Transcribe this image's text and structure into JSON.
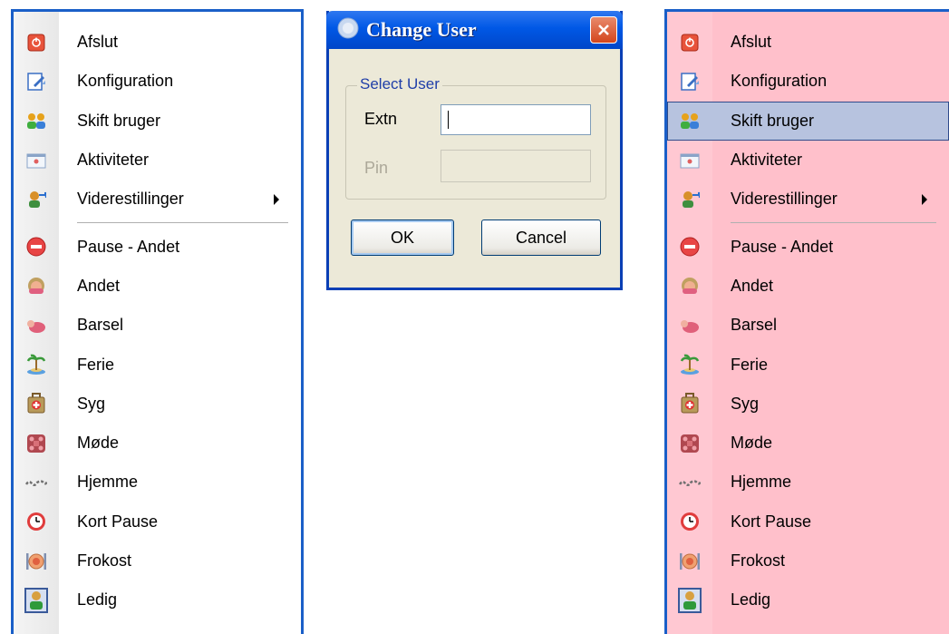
{
  "left_menu": {
    "items_top": [
      {
        "label": "Afslut",
        "icon": "power-icon"
      },
      {
        "label": "Konfiguration",
        "icon": "configuration-icon"
      },
      {
        "label": "Skift bruger",
        "icon": "switch-user-icon"
      },
      {
        "label": "Aktiviteter",
        "icon": "activities-icon"
      },
      {
        "label": "Viderestillinger",
        "icon": "forwarding-icon",
        "submenu": true
      }
    ],
    "items_bottom": [
      {
        "label": "Pause - Andet",
        "icon": "no-entry-icon"
      },
      {
        "label": "Andet",
        "icon": "person-face-icon"
      },
      {
        "label": "Barsel",
        "icon": "baby-icon"
      },
      {
        "label": "Ferie",
        "icon": "palm-island-icon"
      },
      {
        "label": "Syg",
        "icon": "medical-kit-icon"
      },
      {
        "label": "Møde",
        "icon": "meeting-icon"
      },
      {
        "label": "Hjemme",
        "icon": "home-icon"
      },
      {
        "label": "Kort Pause",
        "icon": "clock-icon"
      },
      {
        "label": "Frokost",
        "icon": "lunch-icon"
      },
      {
        "label": "Ledig",
        "icon": "available-user-icon",
        "checked": true
      }
    ]
  },
  "right_menu": {
    "background": "#ffc0cb",
    "highlighted_item": "Skift bruger",
    "items_top": [
      {
        "label": "Afslut"
      },
      {
        "label": "Konfiguration"
      },
      {
        "label": "Skift bruger"
      },
      {
        "label": "Aktiviteter"
      },
      {
        "label": "Viderestillinger"
      }
    ],
    "items_bottom": [
      {
        "label": "Pause - Andet"
      },
      {
        "label": "Andet"
      },
      {
        "label": "Barsel"
      },
      {
        "label": "Ferie"
      },
      {
        "label": "Syg"
      },
      {
        "label": "Møde"
      },
      {
        "label": "Hjemme"
      },
      {
        "label": "Kort Pause"
      },
      {
        "label": "Frokost"
      },
      {
        "label": "Ledig"
      }
    ]
  },
  "dialog": {
    "title": "Change User",
    "group_label": "Select User",
    "extn_label": "Extn",
    "extn_value": "",
    "pin_label": "Pin",
    "pin_value": "",
    "ok_label": "OK",
    "cancel_label": "Cancel"
  },
  "colors": {
    "menu_border": "#1a5fc8",
    "title_bar": "#0058e6",
    "dialog_face": "#ece9d8",
    "highlight": "#b7c3df"
  }
}
